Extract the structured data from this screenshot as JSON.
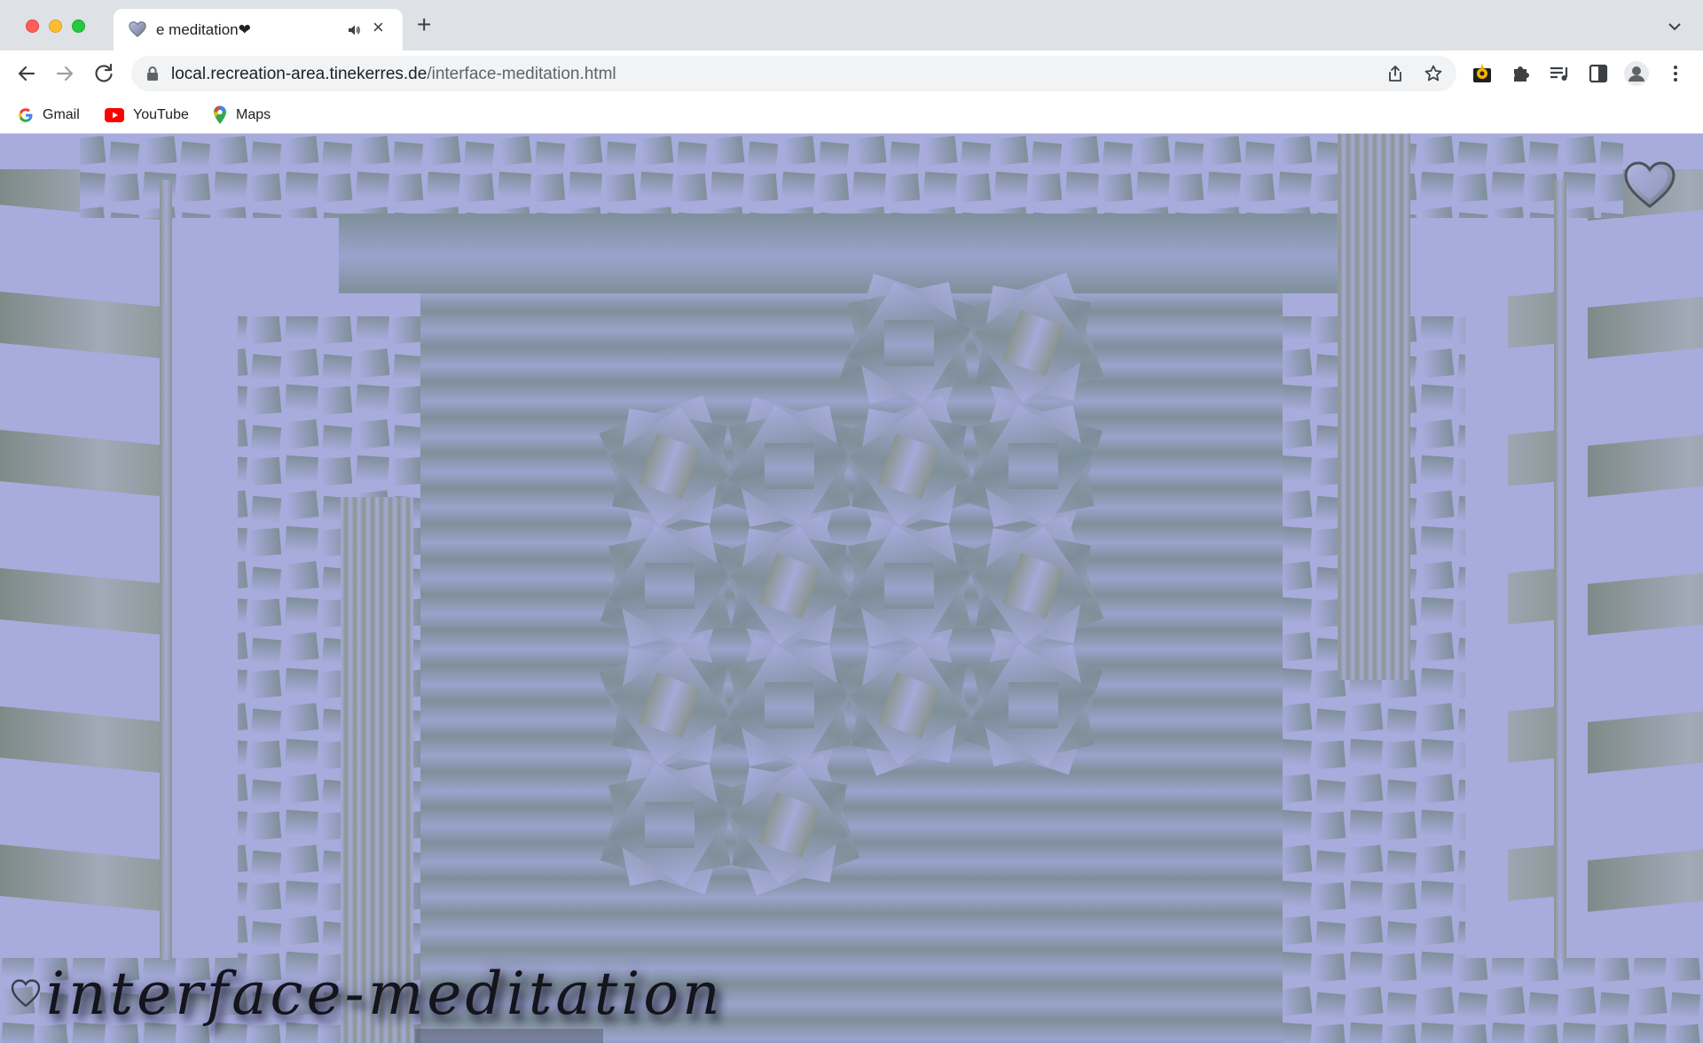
{
  "browser": {
    "tab": {
      "title": "e meditation❤︎",
      "audio_icon": "speaker-icon",
      "close_label": "×"
    },
    "new_tab_label": "+",
    "address": {
      "host": "local.recreation-area.tinekerres.de",
      "path": "/interface-meditation.html"
    },
    "bookmarks": [
      {
        "label": "Gmail",
        "icon": "google-icon"
      },
      {
        "label": "YouTube",
        "icon": "youtube-icon"
      },
      {
        "label": "Maps",
        "icon": "maps-icon"
      }
    ],
    "colors": {
      "tabstrip": "#dee1e6",
      "omnibox": "#f1f3f4"
    }
  },
  "page": {
    "caption": "interface-meditation",
    "icons": [
      "heart-outline-icon",
      "heart-outline-icon"
    ],
    "colors": {
      "lavender": "#a7acdc",
      "slate": "#7f8f9a",
      "gray_green": "#8a9590",
      "ink": "#14141c"
    }
  }
}
